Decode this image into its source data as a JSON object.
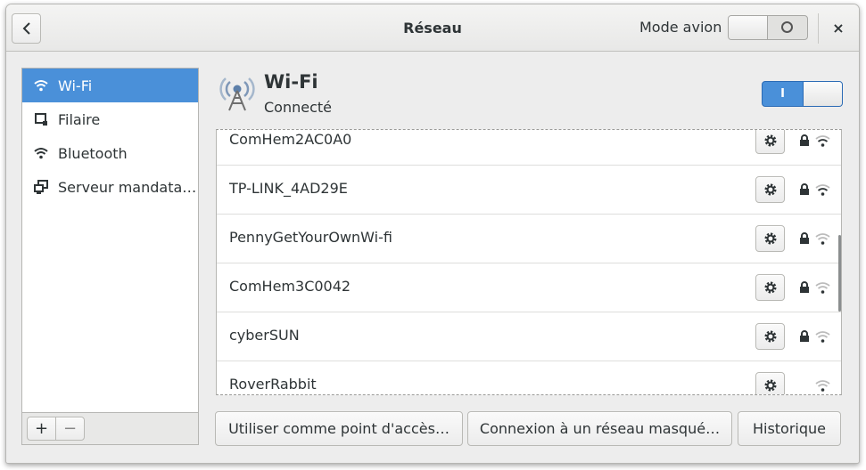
{
  "header": {
    "title": "Réseau",
    "airplane_mode_label": "Mode avion",
    "airplane_mode": "off",
    "close_label": "×"
  },
  "sidebar": {
    "items": [
      {
        "label": "Wi-Fi",
        "icon": "wifi-icon",
        "selected": true
      },
      {
        "label": "Filaire",
        "icon": "wired-network-icon",
        "selected": false
      },
      {
        "label": "Bluetooth",
        "icon": "wifi-icon",
        "selected": false
      },
      {
        "label": "Serveur mandata…",
        "icon": "proxy-network-icon",
        "selected": false
      }
    ],
    "add_label": "+",
    "remove_label": "−"
  },
  "wifi": {
    "title": "Wi-Fi",
    "status": "Connecté",
    "switch_on_label": "I",
    "enabled": true
  },
  "networks": [
    {
      "name": "ComHem2AC0A0",
      "secured": true
    },
    {
      "name": "TP-LINK_4AD29E",
      "secured": true
    },
    {
      "name": "PennyGetYourOwnWi-fi",
      "secured": true
    },
    {
      "name": "ComHem3C0042",
      "secured": true
    },
    {
      "name": "cyberSUN",
      "secured": true
    },
    {
      "name": "RoverRabbit",
      "secured": false
    }
  ],
  "footer": {
    "hotspot_label": "Utiliser comme point d'accès…",
    "hidden_network_label": "Connexion à un réseau masqué…",
    "history_label": "Historique"
  },
  "colors": {
    "accent": "#4a90d9",
    "window_bg": "#ededed",
    "text": "#2e3436"
  }
}
